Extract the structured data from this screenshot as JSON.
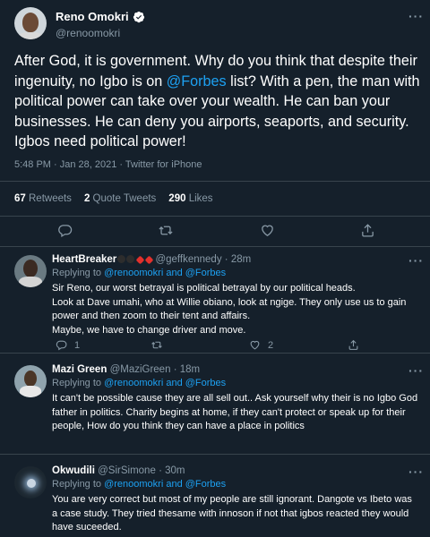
{
  "main_tweet": {
    "display_name": "Reno Omokri",
    "handle": "@renoomokri",
    "text_parts": {
      "p1": "After God, it is government. Why do you think that despite their  ingenuity, no Igbo is on ",
      "mention": "@Forbes",
      "p2": " list? With a pen, the man with political power can take over your wealth. He can ban your businesses. He can deny you airports, seaports, and security. Igbos need political power!"
    },
    "meta": "5:48 PM · Jan 28, 2021 · Twitter for iPhone",
    "stats": {
      "retweets_count": "67",
      "retweets_label": "Retweets",
      "quote_count": "2",
      "quote_label": "Quote Tweets",
      "likes_count": "290",
      "likes_label": "Likes"
    }
  },
  "replies": [
    {
      "name": "HeartBreaker",
      "handle": "@geffkennedy",
      "time": "· 28m",
      "replying_prefix": "Replying to ",
      "replying_to": "@renoomokri and @Forbes",
      "text": "Sir Reno, our worst betrayal is political betrayal by our political heads.\nLook at Dave umahi, who at Willie obiano, look at ngige. They only use us to gain power and then zoom to their tent and affairs.\nMaybe, we have to change driver and move.",
      "reply_count": "1",
      "like_count": "2"
    },
    {
      "name": "Mazi Green",
      "handle": "@MaziGreen",
      "time": "· 18m",
      "replying_prefix": "Replying to ",
      "replying_to": "@renoomokri and @Forbes",
      "text": "It can't be possible cause they are all sell out.. Ask yourself why their is no Igbo God father in politics. Charity begins at home, if they can't protect or speak up for their people, How do you think they can have a place in politics",
      "reply_count": "",
      "like_count": ""
    },
    {
      "name": "Okwudili",
      "handle": "@SirSimone",
      "time": "· 30m",
      "replying_prefix": "Replying to ",
      "replying_to": "@renoomokri and @Forbes",
      "text": "You are very correct but most of my people are still ignorant. Dangote vs Ibeto was a case study. They tried thesame with innoson if not that igbos reacted they would have suceeded.",
      "reply_count": "",
      "like_count": ""
    }
  ],
  "colors": {
    "background": "#15202b",
    "accent": "#1da1f2",
    "muted": "#8899a6",
    "border": "#38444d"
  },
  "icons": {
    "verified": "verified-badge-icon",
    "more": "more-dots-icon",
    "reply": "reply-icon",
    "retweet": "retweet-icon",
    "like": "heart-icon",
    "share": "share-icon"
  },
  "more_symbol": "···"
}
